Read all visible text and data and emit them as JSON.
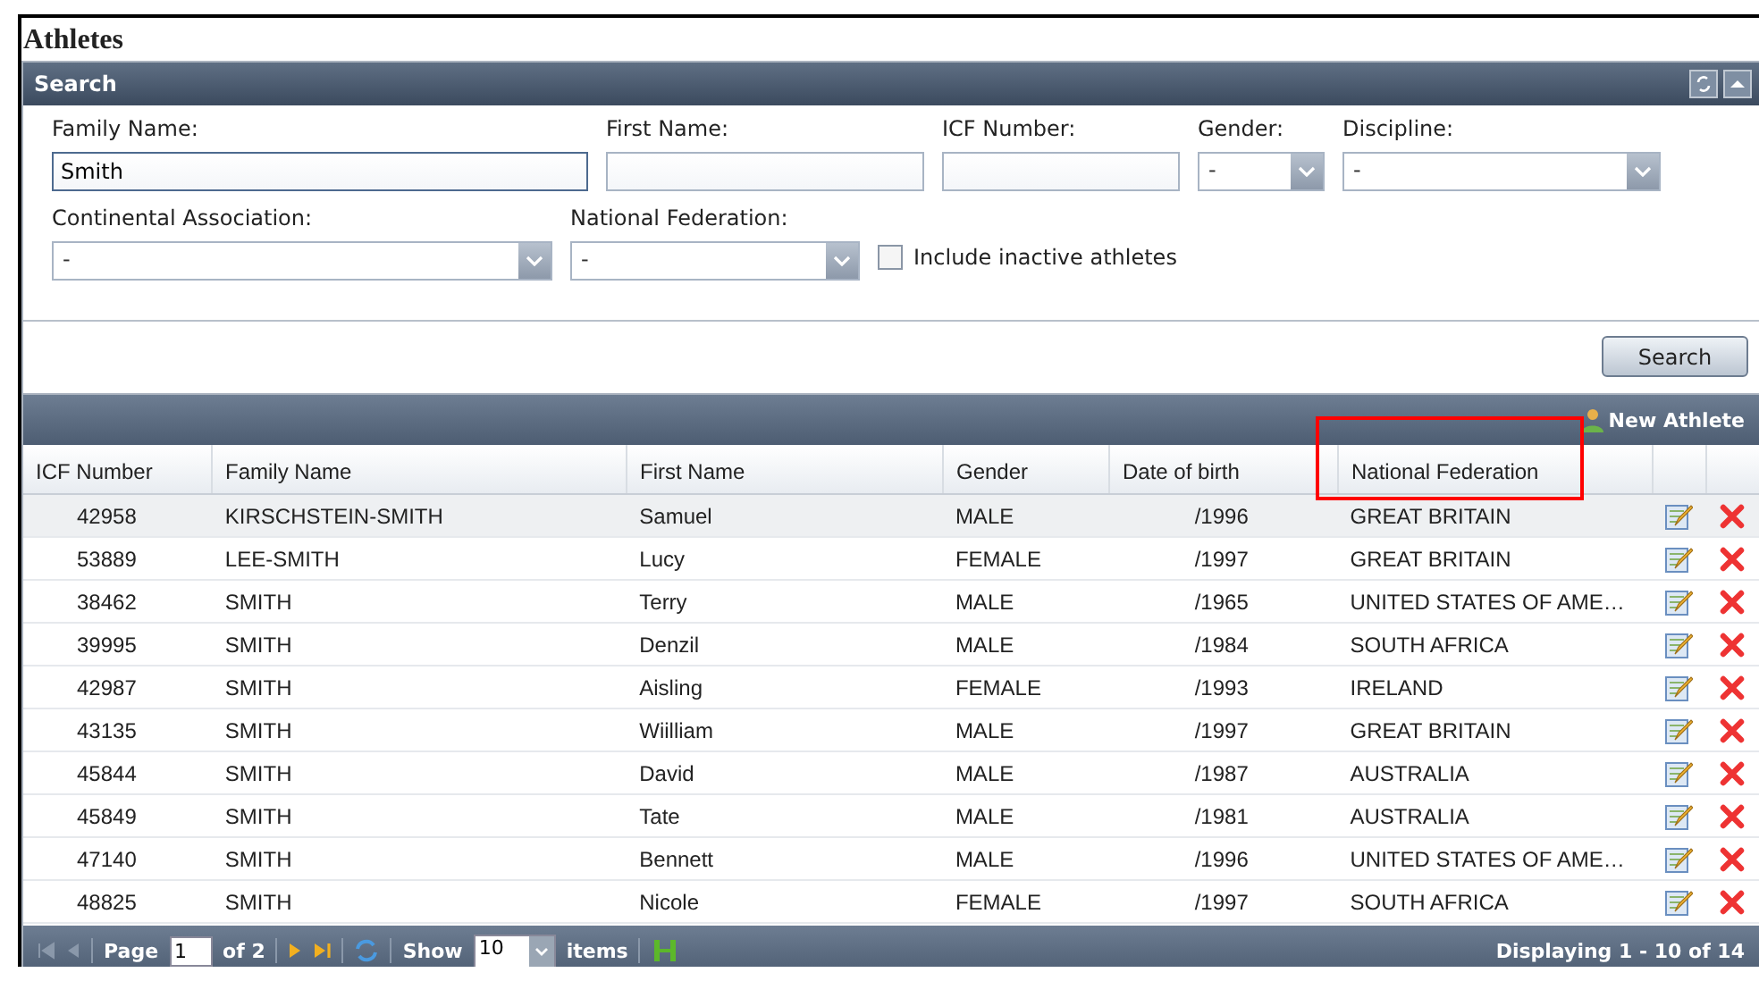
{
  "title": "Athletes",
  "search_panel": {
    "title": "Search",
    "fields": [
      {
        "kind": "text",
        "label": "Family Name:",
        "value": "Smith",
        "focused": true
      },
      {
        "kind": "text",
        "label": "First Name:"
      },
      {
        "kind": "text",
        "label": "ICF Number:"
      },
      {
        "kind": "select",
        "label": "Gender:",
        "value": "-"
      },
      {
        "kind": "select",
        "label": "Discipline:",
        "value": "-"
      },
      {
        "kind": "select",
        "label": "Continental Association:",
        "value": "-"
      },
      {
        "kind": "select",
        "label": "National Federation:",
        "value": "-"
      },
      {
        "kind": "checkbox",
        "label": "Include inactive athletes",
        "checked": false
      }
    ],
    "button": "Search"
  },
  "grid": {
    "new_button": "New Athlete",
    "columns": [
      "ICF Number",
      "Family Name",
      "First Name",
      "Gender",
      "Date of birth",
      "National Federation"
    ],
    "rows": [
      [
        "42958",
        "KIRSCHSTEIN-SMITH",
        "Samuel",
        "MALE",
        "/1996",
        "GREAT BRITAIN"
      ],
      [
        "53889",
        "LEE-SMITH",
        "Lucy",
        "FEMALE",
        "/1997",
        "GREAT BRITAIN"
      ],
      [
        "38462",
        "SMITH",
        "Terry",
        "MALE",
        "/1965",
        "UNITED STATES OF AME…"
      ],
      [
        "39995",
        "SMITH",
        "Denzil",
        "MALE",
        "/1984",
        "SOUTH AFRICA"
      ],
      [
        "42987",
        "SMITH",
        "Aisling",
        "FEMALE",
        "/1993",
        "IRELAND"
      ],
      [
        "43135",
        "SMITH",
        "Wiilliam",
        "MALE",
        "/1997",
        "GREAT BRITAIN"
      ],
      [
        "45844",
        "SMITH",
        "David",
        "MALE",
        "/1987",
        "AUSTRALIA"
      ],
      [
        "45849",
        "SMITH",
        "Tate",
        "MALE",
        "/1981",
        "AUSTRALIA"
      ],
      [
        "47140",
        "SMITH",
        "Bennett",
        "MALE",
        "/1996",
        "UNITED STATES OF AME…"
      ],
      [
        "48825",
        "SMITH",
        "Nicole",
        "FEMALE",
        "/1997",
        "SOUTH AFRICA"
      ]
    ],
    "pager": {
      "page_label": "Page",
      "page": "1",
      "of": "of 2",
      "show_label": "Show",
      "page_size": "10",
      "items_label": "items",
      "status": "Displaying 1 - 10 of 14"
    }
  }
}
